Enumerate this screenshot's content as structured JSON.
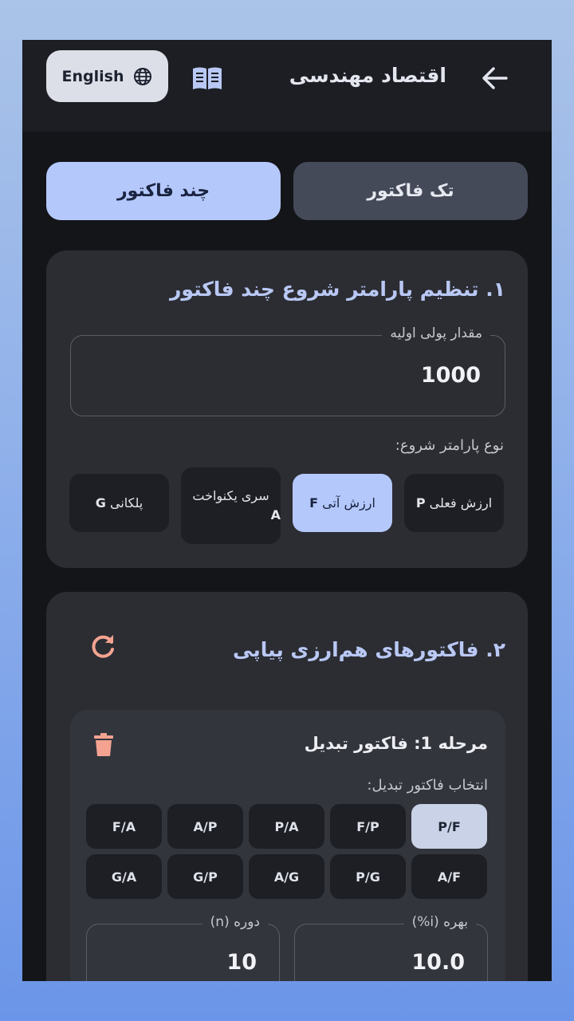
{
  "appbar": {
    "title": "اقتصاد مهندسی",
    "language_label": "English",
    "icons": [
      "arrow-back-icon",
      "book-icon",
      "globe-icon"
    ]
  },
  "tabs": {
    "single": "تک فاکتور",
    "multi": "چند فاکتور",
    "active": "multi"
  },
  "section1": {
    "title": "۱. تنظیم پارامتر شروع چند فاکتور",
    "initial_amount_label": "مقدار پولی اولیه",
    "initial_amount_value": "1000",
    "start_param_label": "نوع پارامتر شروع:",
    "options": [
      {
        "text": "ارزش فعلی",
        "code": "P",
        "selected": false
      },
      {
        "text": "ارزش آتی",
        "code": "F",
        "selected": true
      },
      {
        "text": "سری یکنواخت",
        "code": "A",
        "selected": false
      },
      {
        "text": "پلکانی",
        "code": "G",
        "selected": false
      }
    ]
  },
  "section2": {
    "title": "۲. فاکتورهای هم‌ارزی پیاپی",
    "step": {
      "prefix": "مرحله",
      "number": "1:",
      "name": "فاکتور تبدیل",
      "select_label": "انتخاب فاکتور تبدیل:",
      "row1": [
        "P/F",
        "F/P",
        "P/A",
        "A/P",
        "F/A"
      ],
      "row2": [
        "A/F",
        "P/G",
        "A/G",
        "G/P",
        "G/A"
      ],
      "selected": "P/F",
      "interest_label": "بهره (i%)",
      "interest_value": "10.0",
      "period_label": "دوره (n)",
      "period_value": "10"
    }
  },
  "colors": {
    "accent": "#b4c8fb",
    "title_blue": "#b9c8f4",
    "danger": "#f4a391",
    "surface": "#2c2d33",
    "background": "#141519"
  }
}
